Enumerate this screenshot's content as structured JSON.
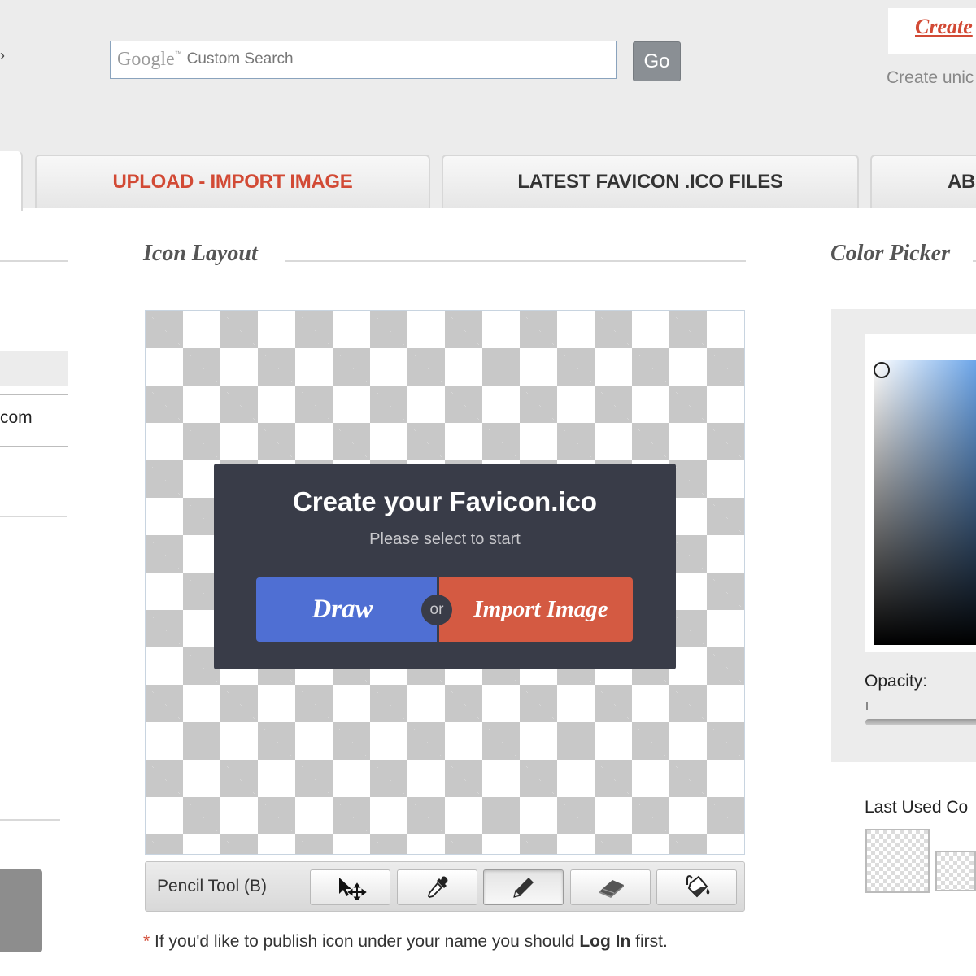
{
  "header": {
    "search": {
      "brand": "Google",
      "brand_tm": "™",
      "placeholder": "Custom Search"
    },
    "go_label": "Go",
    "create_link": "Create",
    "create_subtext": "Create unic"
  },
  "tabs": [
    {
      "label": "UPLOAD - IMPORT IMAGE"
    },
    {
      "label": "LATEST FAVICON .ICO FILES"
    },
    {
      "label": "ABO"
    }
  ],
  "left": {
    "field_value": "com"
  },
  "icon_layout": {
    "title": "Icon Layout",
    "dialog": {
      "title": "Create your Favicon.ico",
      "subtitle": "Please select to start",
      "draw_label": "Draw",
      "or_label": "or",
      "import_label": "Import Image"
    }
  },
  "toolbar": {
    "current_tool": "Pencil Tool (B)",
    "tools": [
      "move-select",
      "eyedropper",
      "pencil",
      "eraser",
      "paint-bucket"
    ],
    "active_tool": "pencil"
  },
  "note": {
    "star": "*",
    "text_before": " If you'd like to publish icon under your name you should ",
    "login": "Log In",
    "text_after": " first."
  },
  "color_picker": {
    "title": "Color Picker",
    "opacity_label": "Opacity:",
    "last_used_label": "Last Used Co",
    "hue_color": "#5b9be6"
  },
  "colors": {
    "accent_red": "#d24a35",
    "draw_blue": "#4f6fd3",
    "import_orange": "#d45a42",
    "dialog_bg": "#393c48"
  }
}
